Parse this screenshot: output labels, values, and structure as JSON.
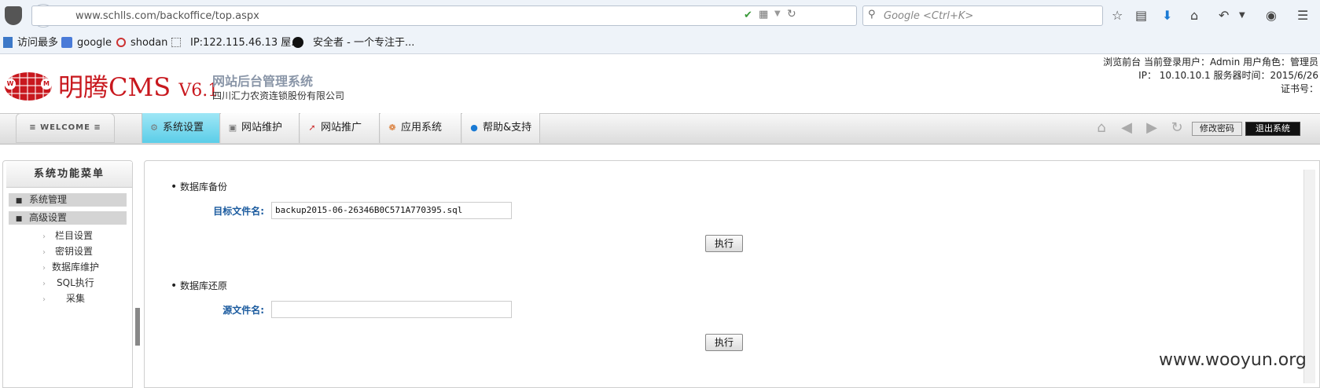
{
  "browser": {
    "url": "www.schlls.com/backoffice/top.aspx",
    "search_placeholder": "Google <Ctrl+K>",
    "bookmarks": [
      "访问最多",
      "google",
      "shodan",
      "IP:122.115.46.13 屋...",
      "安全者 - 一个专注于..."
    ]
  },
  "header": {
    "brand": "明腾CMS",
    "version": "V6.1",
    "subtitle": "网站后台管理系统",
    "company": "四川汇力农资连锁股份有限公司",
    "right_line1": "浏览前台 当前登录用户：Admin 用户角色：管理员",
    "right_line2": "IP： 10.10.10.1 服务器时间：2015/6/26",
    "right_line3": "证书号："
  },
  "nav": {
    "welcome": "≡ WELCOME ≡",
    "tabs": [
      "系统设置",
      "网站维护",
      "网站推广",
      "应用系统",
      "帮助&支持"
    ],
    "change_password": "修改密码",
    "logout": "退出系统"
  },
  "sidebar": {
    "title": "系统功能菜单",
    "groups": [
      "系统管理",
      "高级设置"
    ],
    "items": [
      "栏目设置",
      "密钥设置",
      "数据库维护",
      "SQL执行",
      "采集"
    ]
  },
  "backup": {
    "title": "数据库备份",
    "label": "目标文件名:",
    "value": "backup2015-06-26346B0C571A770395.sql",
    "button": "执行"
  },
  "restore": {
    "title": "数据库还原",
    "label": "源文件名:",
    "value": "",
    "button": "执行"
  },
  "watermark": "www.wooyun.org",
  "colors": {
    "brand_red": "#c8181e",
    "active_tab": "#5bcde8",
    "label_blue": "#1a5a9e"
  }
}
